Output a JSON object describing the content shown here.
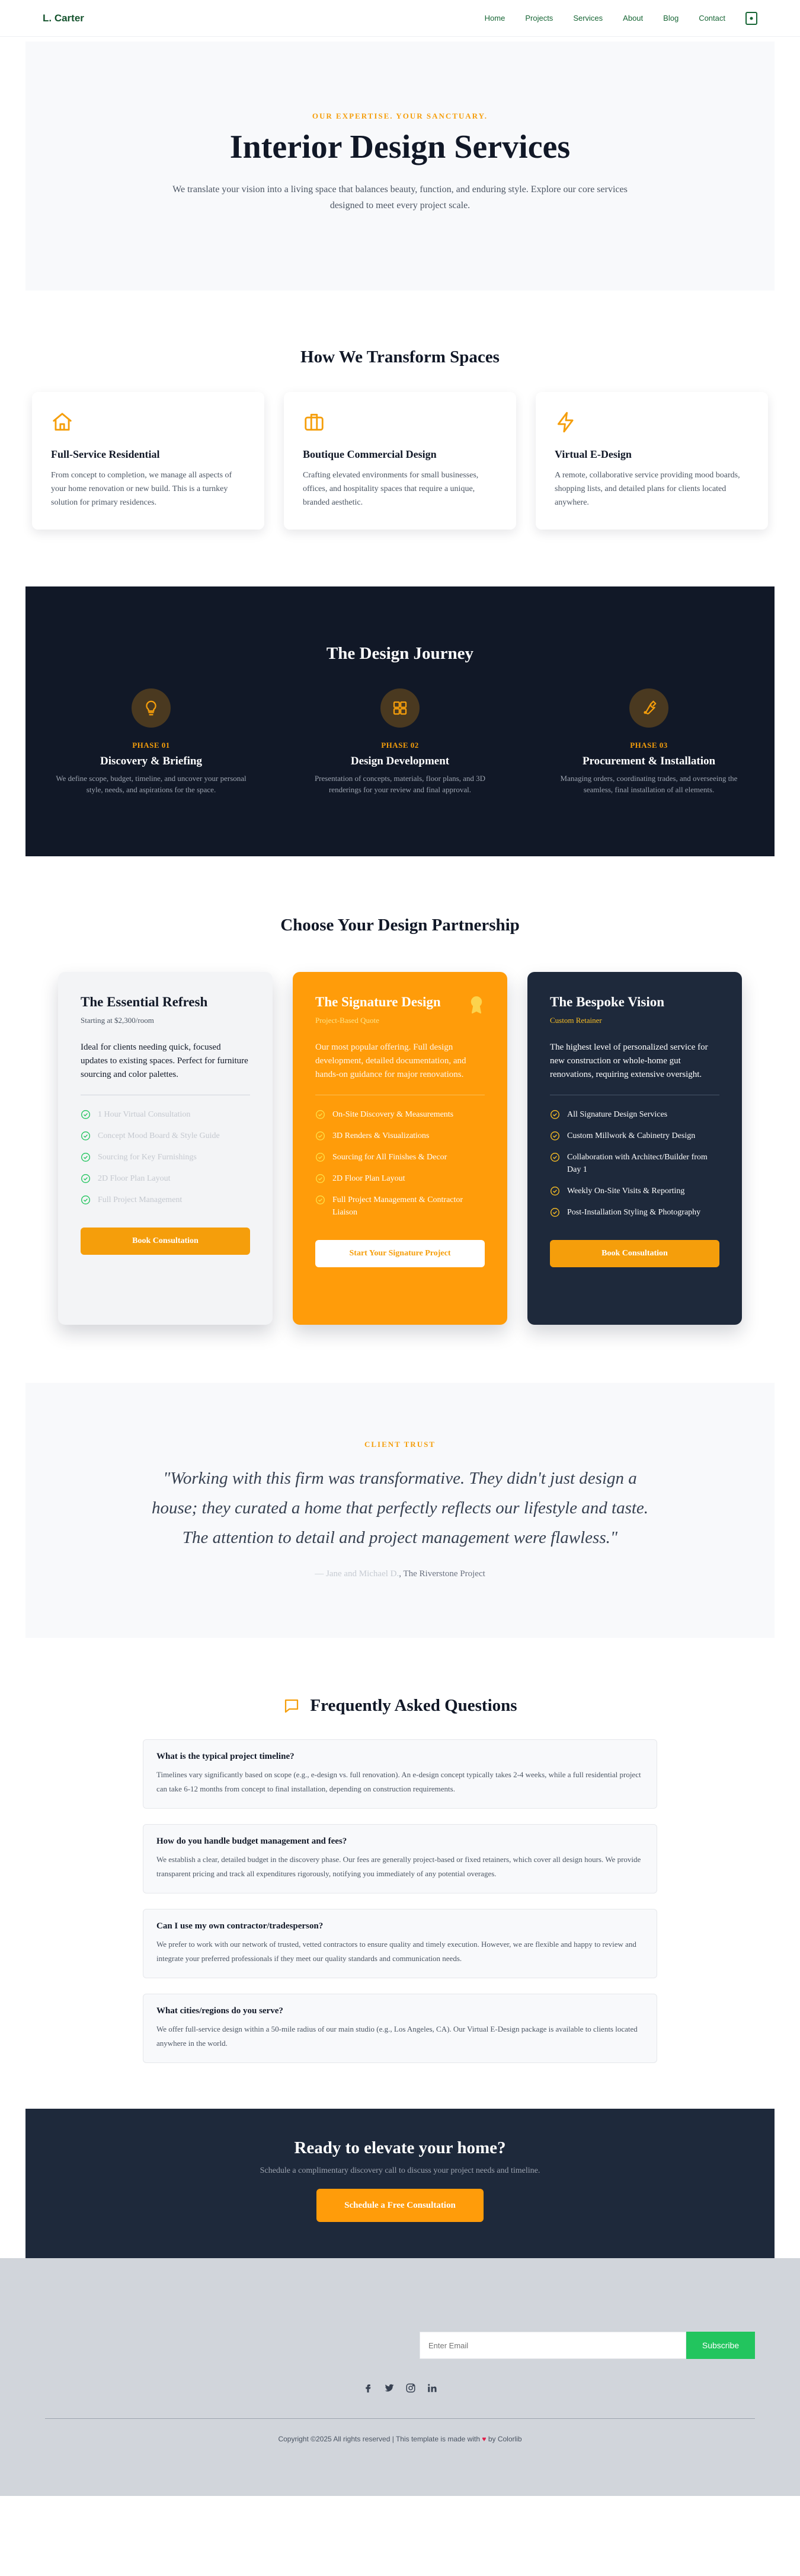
{
  "nav": {
    "brand": "L. Carter",
    "links": [
      "Home",
      "Projects",
      "Services",
      "About",
      "Blog",
      "Contact"
    ],
    "cart_icon": "shopping-bag-icon"
  },
  "hero": {
    "eyebrow": "OUR EXPERTISE. YOUR SANCTUARY.",
    "title": "Interior Design Services",
    "text": "We translate your vision into a living space that balances beauty, function, and enduring style. Explore our core services designed to meet every project scale."
  },
  "services": {
    "title": "How We Transform Spaces",
    "items": [
      {
        "icon": "home-icon",
        "title": "Full-Service Residential",
        "text": "From concept to completion, we manage all aspects of your home renovation or new build. This is a turnkey solution for primary residences."
      },
      {
        "icon": "briefcase-icon",
        "title": "Boutique Commercial Design",
        "text": "Crafting elevated environments for small businesses, offices, and hospitality spaces that require a unique, branded aesthetic."
      },
      {
        "icon": "lightning-icon",
        "title": "Virtual E-Design",
        "text": "A remote, collaborative service providing mood boards, shopping lists, and detailed plans for clients located anywhere."
      }
    ]
  },
  "journey": {
    "title": "The Design Journey",
    "steps": [
      {
        "icon": "lightbulb-icon",
        "phase": "PHASE 01",
        "title": "Discovery & Briefing",
        "text": "We define scope, budget, timeline, and uncover your personal style, needs, and aspirations for the space."
      },
      {
        "icon": "grid-icon",
        "phase": "PHASE 02",
        "title": "Design Development",
        "text": "Presentation of concepts, materials, floor plans, and 3D renderings for your review and final approval."
      },
      {
        "icon": "wrench-icon",
        "phase": "PHASE 03",
        "title": "Procurement & Installation",
        "text": "Managing orders, coordinating trades, and overseeing the seamless, final installation of all elements."
      }
    ]
  },
  "pricing": {
    "title": "Choose Your Design Partnership",
    "plans": [
      {
        "title": "The Essential Refresh",
        "sub": "Starting at $2,300/room",
        "desc": "Ideal for clients needing quick, focused updates to existing spaces. Perfect for furniture sourcing and color palettes.",
        "features": [
          "1 Hour Virtual Consultation",
          "Concept Mood Board & Style Guide",
          "Sourcing for Key Furnishings",
          "2D Floor Plan Layout",
          "Full Project Management"
        ],
        "button": "Book Consultation"
      },
      {
        "title": "The Signature Design",
        "sub": "Project-Based Quote",
        "desc": "Our most popular offering. Full design development, detailed documentation, and hands-on guidance for major renovations.",
        "features": [
          "On-Site Discovery & Measurements",
          "3D Renders & Visualizations",
          "Sourcing for All Finishes & Decor",
          "2D Floor Plan Layout",
          "Full Project Management & Contractor Liaison"
        ],
        "button": "Start Your Signature Project",
        "badge_icon": "award-icon"
      },
      {
        "title": "The Bespoke Vision",
        "sub": "Custom Retainer",
        "desc": "The highest level of personalized service for new construction or whole-home gut renovations, requiring extensive oversight.",
        "features": [
          "All Signature Design Services",
          "Custom Millwork & Cabinetry Design",
          "Collaboration with Architect/Builder from Day 1",
          "Weekly On-Site Visits & Reporting",
          "Post-Installation Styling & Photography"
        ],
        "button": "Book Consultation"
      }
    ]
  },
  "testimonial": {
    "eyebrow": "CLIENT TRUST",
    "quote": "\"Working with this firm was transformative. They didn't just design a house; they curated a home that perfectly reflects our lifestyle and taste. The attention to detail and project management were flawless.\"",
    "author": "— Jane and Michael D.",
    "project": ", The Riverstone Project"
  },
  "faq": {
    "title": "Frequently Asked Questions",
    "icon": "chat-icon",
    "items": [
      {
        "q": "What is the typical project timeline?",
        "a": "Timelines vary significantly based on scope (e.g., e-design vs. full renovation). An e-design concept typically takes 2-4 weeks, while a full residential project can take 6-12 months from concept to final installation, depending on construction requirements."
      },
      {
        "q": "How do you handle budget management and fees?",
        "a": "We establish a clear, detailed budget in the discovery phase. Our fees are generally project-based or fixed retainers, which cover all design hours. We provide transparent pricing and track all expenditures rigorously, notifying you immediately of any potential overages."
      },
      {
        "q": "Can I use my own contractor/tradesperson?",
        "a": "We prefer to work with our network of trusted, vetted contractors to ensure quality and timely execution. However, we are flexible and happy to review and integrate your preferred professionals if they meet our quality standards and communication needs."
      },
      {
        "q": "What cities/regions do you serve?",
        "a": "We offer full-service design within a 50-mile radius of our main studio (e.g., Los Angeles, CA). Our Virtual E-Design package is available to clients located anywhere in the world."
      }
    ]
  },
  "cta": {
    "title": "Ready to elevate your home?",
    "text": "Schedule a complimentary discovery call to discuss your project needs and timeline.",
    "button": "Schedule a Free Consultation"
  },
  "footer": {
    "email_placeholder": "Enter Email",
    "subscribe": "Subscribe",
    "social": [
      "facebook-icon",
      "twitter-icon",
      "instagram-icon",
      "linkedin-icon"
    ],
    "copyright_pre": "Copyright ©2025 All rights reserved | This template is made with",
    "copyright_post": "by Colorlib"
  },
  "colors": {
    "accent": "#f59e0b",
    "dark": "#111827",
    "navy": "#1e293b",
    "green": "#22c55e"
  }
}
